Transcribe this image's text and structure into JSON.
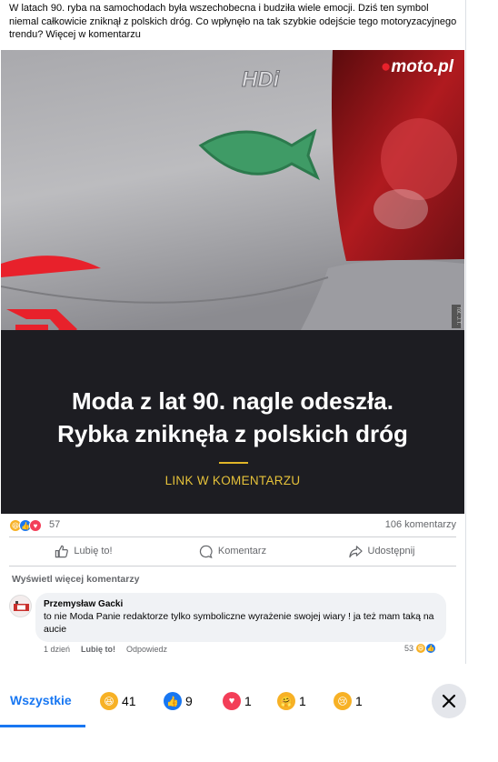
{
  "post": {
    "text": "W latach 90. ryba na samochodach była wszechobecna i budziła wiele emocji. Dziś ten symbol niemal całkowicie zniknął z polskich dróg. Co wpłynęło na tak szybkie odejście tego motoryzacyjnego trendu? Więcej w komentarzu",
    "image": {
      "brand_logo": "moto.pl",
      "car_badge": "HDi",
      "side_credit": "fot. J.T.",
      "headline_line1": "Moda z lat 90. nagle odeszła.",
      "headline_line2": "Rybka zniknęła z polskich dróg",
      "cta": "LINK W KOMENTARZU"
    },
    "reaction_icons": [
      "haha-icon",
      "like-icon",
      "love-icon"
    ],
    "reaction_count": "57",
    "comment_count": "106 komentarzy"
  },
  "actions": {
    "like": "Lubię to!",
    "comment": "Komentarz",
    "share": "Udostępnij"
  },
  "more_comments": "Wyświetl więcej komentarzy",
  "comment": {
    "author": "Przemysław Gacki",
    "text": "to nie Moda Panie redaktorze tylko symboliczne wyrażenie swojej wiary ! ja też mam taką na aucie",
    "time": "1 dzień",
    "like": "Lubię to!",
    "reply": "Odpowiedz",
    "reaction_count": "53"
  },
  "reactions_sheet": {
    "all_tab": "Wszystkie",
    "tabs": [
      {
        "icon": "haha-icon",
        "count": "41"
      },
      {
        "icon": "like-icon",
        "count": "9"
      },
      {
        "icon": "love-icon",
        "count": "1"
      },
      {
        "icon": "care-icon",
        "count": "1"
      },
      {
        "icon": "sad-icon",
        "count": "1"
      }
    ]
  },
  "colors": {
    "accent": "#1877f2",
    "brand_red": "#e8212b",
    "banner_bg": "#1d1d22",
    "cta_gold": "#e6c23a"
  }
}
